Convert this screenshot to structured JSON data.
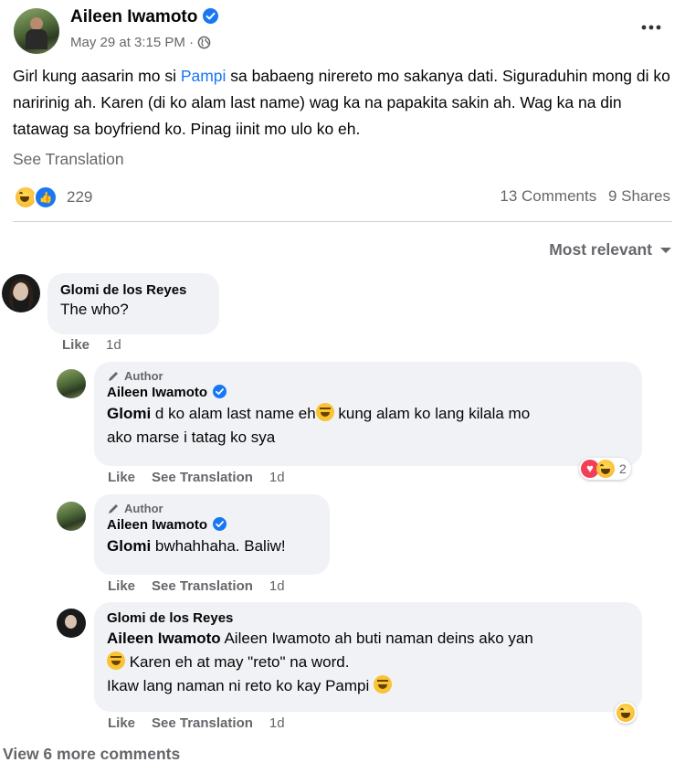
{
  "post": {
    "author": "Aileen Iwamoto",
    "timestamp": "May 29 at 3:15 PM · ",
    "text_before": "Girl kung aasarin mo si ",
    "mention": "Pampi",
    "text_after": " sa babaeng nirereto mo sakanya dati. Siguraduhin mong di ko naririnig ah. Karen (di ko alam last name) wag ka na papakita sakin ah. Wag ka na din tatawag sa boyfriend ko. Pinag iinit mo ulo ko eh.",
    "see_translation": "See Translation",
    "reaction_count": "229",
    "comments_count": "13 Comments",
    "shares_count": "9 Shares",
    "more_icon": "more-horizontal-icon",
    "audience_icon": "globe-icon"
  },
  "sort": {
    "label": "Most relevant"
  },
  "comments": [
    {
      "name": "Glomi de los Reyes",
      "text": "The who?",
      "like": "Like",
      "time": "1d"
    },
    {
      "badge": "Author",
      "name": "Aileen Iwamoto",
      "mention": "Glomi",
      "text1": " d ko alam last name eh",
      "text2": " kung alam ko lang kilala mo",
      "text3": "ako marse i tatag ko sya",
      "like": "Like",
      "see_translation": "See Translation",
      "time": "1d",
      "reaction_count": "2"
    },
    {
      "badge": "Author",
      "name": "Aileen Iwamoto",
      "mention": "Glomi",
      "text": " bwhahhaha. Baliw!",
      "like": "Like",
      "see_translation": "See Translation",
      "time": "1d"
    },
    {
      "name": "Glomi de los Reyes",
      "mention": "Aileen Iwamoto",
      "line1": " Aileen Iwamoto ah buti naman deins ako yan",
      "line2": " Karen eh at may \"reto\" na word.",
      "line3": "Ikaw lang naman ni reto ko kay Pampi ",
      "like": "Like",
      "see_translation": "See Translation",
      "time": "1d"
    }
  ],
  "view_more": "View 6 more comments",
  "colors": {
    "accent": "#1877f2",
    "bubble": "#f0f2f5",
    "muted": "#65676b"
  }
}
